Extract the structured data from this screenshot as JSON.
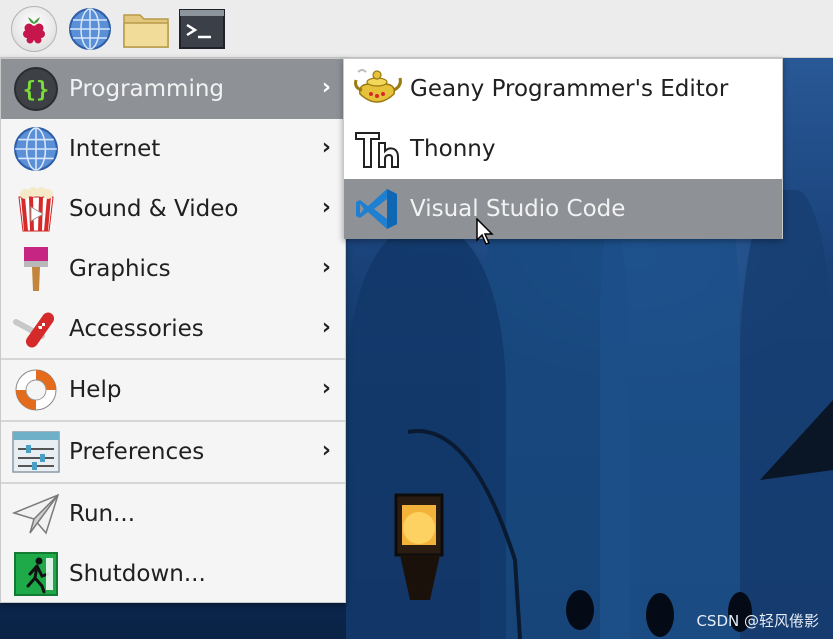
{
  "taskbar": {
    "icons": [
      "raspberry-pi-menu-icon",
      "web-browser-icon",
      "file-manager-icon",
      "terminal-icon"
    ]
  },
  "main_menu": {
    "items": [
      {
        "label": "Programming",
        "icon": "curly-braces-icon",
        "has_submenu": true,
        "active": true
      },
      {
        "label": "Internet",
        "icon": "globe-icon",
        "has_submenu": true
      },
      {
        "label": "Sound & Video",
        "icon": "popcorn-play-icon",
        "has_submenu": true
      },
      {
        "label": "Graphics",
        "icon": "paintbrush-icon",
        "has_submenu": true
      },
      {
        "label": "Accessories",
        "icon": "swiss-knife-icon",
        "has_submenu": true
      },
      {
        "label": "Help",
        "icon": "lifebuoy-icon",
        "has_submenu": true
      },
      {
        "label": "Preferences",
        "icon": "sliders-icon",
        "has_submenu": true
      },
      {
        "label": "Run...",
        "icon": "paper-plane-icon",
        "has_submenu": false
      },
      {
        "label": "Shutdown...",
        "icon": "exit-running-man-icon",
        "has_submenu": false
      }
    ]
  },
  "sub_menu": {
    "items": [
      {
        "label": "Geany Programmer's Editor",
        "icon": "geany-lamp-icon"
      },
      {
        "label": "Thonny",
        "icon": "thonny-th-icon"
      },
      {
        "label": "Visual Studio Code",
        "icon": "vscode-icon",
        "active": true
      }
    ]
  },
  "watermark": "CSDN @轻风倦影",
  "colors": {
    "active_item": "#8e9297",
    "menu_bg": "#f5f5f5",
    "taskbar_bg": "#ececec"
  }
}
